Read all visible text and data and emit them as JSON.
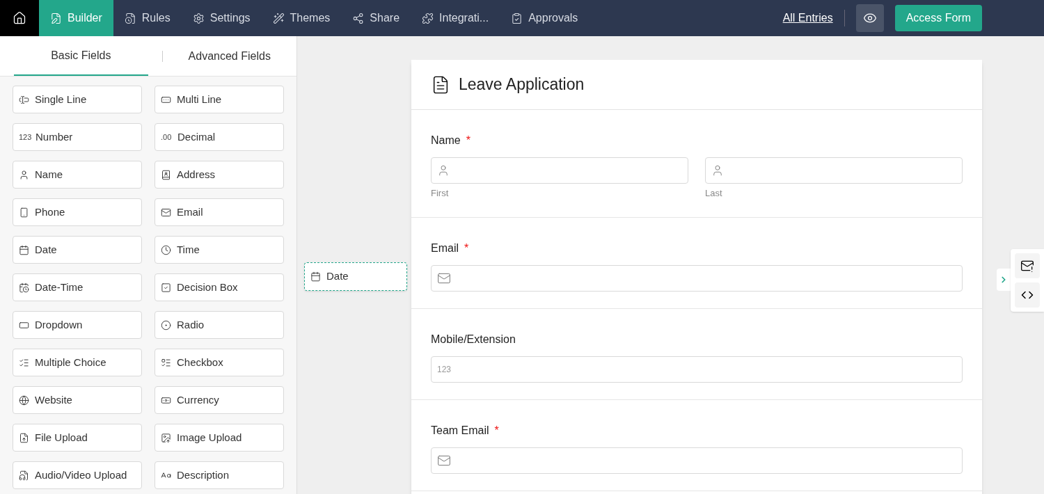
{
  "nav": {
    "tabs": [
      {
        "label": "Builder",
        "selected": true
      },
      {
        "label": "Rules",
        "selected": false
      },
      {
        "label": "Settings",
        "selected": false
      },
      {
        "label": "Themes",
        "selected": false
      },
      {
        "label": "Share",
        "selected": false
      },
      {
        "label": "Integrati...",
        "selected": false
      },
      {
        "label": "Approvals",
        "selected": false
      }
    ],
    "link": "All Entries",
    "button": "Access Form"
  },
  "sidebar": {
    "tabs": [
      {
        "label": "Basic Fields",
        "selected": true
      },
      {
        "label": "Advanced Fields",
        "selected": false
      }
    ],
    "items": [
      {
        "label": "Single Line"
      },
      {
        "label": "Multi Line"
      },
      {
        "label": "Number",
        "glyph": "123"
      },
      {
        "label": "Decimal",
        "glyph": ".00"
      },
      {
        "label": "Name"
      },
      {
        "label": "Address"
      },
      {
        "label": "Phone"
      },
      {
        "label": "Email"
      },
      {
        "label": "Date"
      },
      {
        "label": "Time"
      },
      {
        "label": "Date-Time"
      },
      {
        "label": "Decision Box"
      },
      {
        "label": "Dropdown"
      },
      {
        "label": "Radio"
      },
      {
        "label": "Multiple Choice"
      },
      {
        "label": "Checkbox"
      },
      {
        "label": "Website"
      },
      {
        "label": "Currency"
      },
      {
        "label": "File Upload"
      },
      {
        "label": "Image Upload"
      },
      {
        "label": "Audio/Video Upload"
      },
      {
        "label": "Description"
      }
    ]
  },
  "drag_item": {
    "label": "Date"
  },
  "form": {
    "title": "Leave Application",
    "fields": [
      {
        "kind": "name",
        "label": "Name",
        "required_mark": "*",
        "subfields": [
          "First",
          "Last"
        ]
      },
      {
        "kind": "email",
        "label": "Email",
        "required_mark": "*"
      },
      {
        "kind": "number",
        "label": "Mobile/Extension",
        "glyph": "123"
      },
      {
        "kind": "email",
        "label": "Team Email",
        "required_mark": "*"
      }
    ]
  }
}
